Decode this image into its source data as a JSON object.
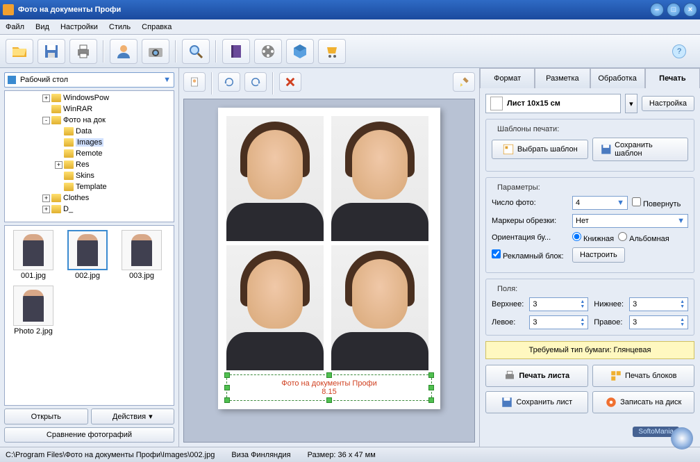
{
  "window": {
    "title": "Фото на документы Профи"
  },
  "menu": [
    "Файл",
    "Вид",
    "Настройки",
    "Стиль",
    "Справка"
  ],
  "left": {
    "combo": "Рабочий стол",
    "tree": [
      {
        "lvl": 2,
        "exp": "+",
        "label": "WindowsPow"
      },
      {
        "lvl": 2,
        "exp": "",
        "label": "WinRAR"
      },
      {
        "lvl": 2,
        "exp": "-",
        "label": "Фото на док"
      },
      {
        "lvl": 3,
        "exp": "",
        "label": "Data"
      },
      {
        "lvl": 3,
        "exp": "",
        "label": "Images",
        "sel": true
      },
      {
        "lvl": 3,
        "exp": "",
        "label": "Remote"
      },
      {
        "lvl": 3,
        "exp": "+",
        "label": "Res"
      },
      {
        "lvl": 3,
        "exp": "",
        "label": "Skins"
      },
      {
        "lvl": 3,
        "exp": "",
        "label": "Template"
      },
      {
        "lvl": 2,
        "exp": "+",
        "label": "Clothes"
      },
      {
        "lvl": 2,
        "exp": "+",
        "label": "D_"
      }
    ],
    "thumbs": [
      {
        "name": "001.jpg"
      },
      {
        "name": "002.jpg",
        "sel": true
      },
      {
        "name": "003.jpg"
      },
      {
        "name": "Photo 2.jpg"
      }
    ],
    "open": "Открыть",
    "actions": "Действия",
    "compare": "Сравнение фотографий"
  },
  "canvas": {
    "watermark_line1": "Фото на документы Профи",
    "watermark_line2": "8.15"
  },
  "right": {
    "tabs": [
      "Формат",
      "Разметка",
      "Обработка",
      "Печать"
    ],
    "active_tab": 3,
    "sheet": "Лист 10х15 см",
    "settings_btn": "Настройка",
    "templates": {
      "title": "Шаблоны печати:",
      "select": "Выбрать шаблон",
      "save": "Сохранить шаблон"
    },
    "params": {
      "title": "Параметры:",
      "photo_count_lbl": "Число фото:",
      "photo_count": "4",
      "rotate": "Повернуть",
      "crop_lbl": "Маркеры обрезки:",
      "crop_val": "Нет",
      "orient_lbl": "Ориентация бу...",
      "orient_portrait": "Книжная",
      "orient_landscape": "Альбомная",
      "ad_block": "Рекламный блок:",
      "configure": "Настроить"
    },
    "margins": {
      "title": "Поля:",
      "top_lbl": "Верхнее:",
      "top": "3",
      "bottom_lbl": "Нижнее:",
      "bottom": "3",
      "left_lbl": "Левое:",
      "left": "3",
      "right_lbl": "Правое:",
      "right": "3"
    },
    "paper": "Требуемый тип бумаги: Глянцевая",
    "actions": {
      "print_sheet": "Печать листа",
      "print_blocks": "Печать блоков",
      "save_sheet": "Сохранить лист",
      "burn": "Записать на диск"
    }
  },
  "status": {
    "path": "C:\\Program Files\\Фото на документы Профи\\Images\\002.jpg",
    "doc": "Виза Финляндия",
    "size": "Размер: 36 x 47 мм"
  },
  "brand": "SoftoMania"
}
